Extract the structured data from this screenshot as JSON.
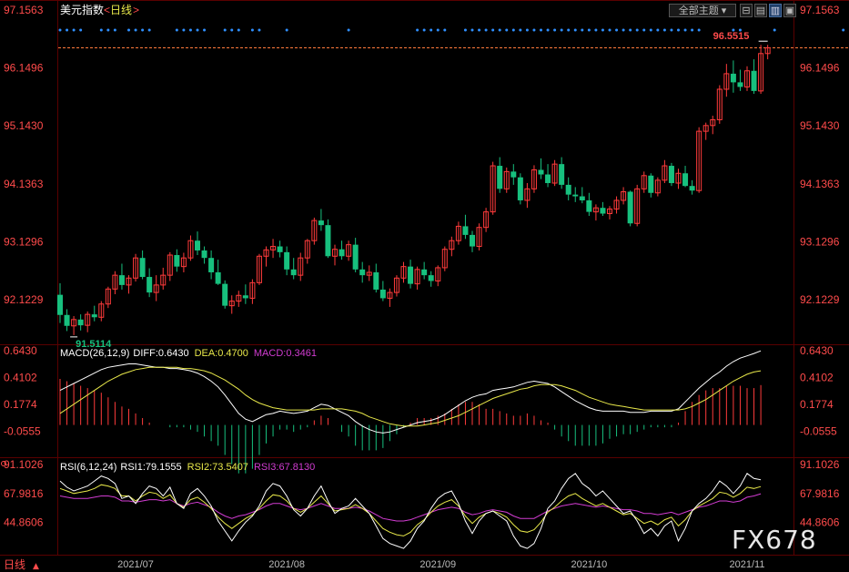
{
  "header": {
    "title": "美元指数",
    "period_open": "<",
    "period": "日线",
    "period_close": ">"
  },
  "toolbar": {
    "theme_label": "全部主题",
    "theme_arrow": "▾",
    "btn1": "⊟",
    "btn2": "▤",
    "btn3": "▥",
    "btn4": "▣"
  },
  "bottom": {
    "period_label": "日线",
    "arrow": "▲"
  },
  "watermark": "FX678",
  "colors": {
    "up": "#ff3b3b",
    "down": "#17c07e",
    "axis_text": "#ff4b4b",
    "white": "#ffffff",
    "yellow": "#e8e84a",
    "magenta": "#d23cd2",
    "dot_blue": "#2f8fff"
  },
  "chart_data": [
    {
      "type": "candlestick",
      "title": "美元指数",
      "y_ticks": [
        "97.1563",
        "96.1496",
        "95.1430",
        "94.1363",
        "93.1296",
        "92.1229"
      ],
      "ylim": [
        91.35,
        97.33
      ],
      "x_labels": [
        "2021/07",
        "2021/08",
        "2021/09",
        "2021/10",
        "2021/11"
      ],
      "label_candle": [
        11,
        33,
        55,
        77,
        100
      ],
      "max_label": "96.5515",
      "min_label": "91.5114",
      "dot_pattern": [
        1,
        1,
        1,
        1,
        0,
        0,
        1,
        1,
        1,
        0,
        1,
        1,
        1,
        1,
        0,
        0,
        0,
        1,
        1,
        1,
        1,
        1,
        0,
        0,
        1,
        1,
        1,
        0,
        1,
        1,
        0,
        0,
        0,
        1,
        0,
        0,
        0,
        0,
        0,
        0,
        0,
        0,
        1,
        0,
        0,
        0,
        0,
        0,
        0,
        0,
        0,
        0,
        1,
        1,
        1,
        1,
        1,
        0,
        0,
        1,
        1,
        1,
        1,
        1,
        1,
        1,
        1,
        1,
        1,
        1,
        1,
        1,
        1,
        1,
        1,
        1,
        1,
        1,
        1,
        1,
        1,
        1,
        1,
        1,
        1,
        1,
        1,
        1,
        1,
        1,
        1,
        1,
        1,
        1,
        0,
        0,
        0,
        0,
        1,
        1,
        0,
        0,
        0,
        0,
        1,
        0,
        0,
        0,
        0,
        0,
        0,
        0,
        0,
        0,
        1
      ],
      "ohlc": [
        [
          92.21,
          92.41,
          91.72,
          91.86
        ],
        [
          91.86,
          91.96,
          91.58,
          91.67
        ],
        [
          91.67,
          91.84,
          91.51,
          91.78
        ],
        [
          91.78,
          91.87,
          91.59,
          91.68
        ],
        [
          91.68,
          91.92,
          91.56,
          91.87
        ],
        [
          91.87,
          92.02,
          91.75,
          91.82
        ],
        [
          91.82,
          92.1,
          91.75,
          92.05
        ],
        [
          92.05,
          92.35,
          91.98,
          92.31
        ],
        [
          92.31,
          92.62,
          92.22,
          92.55
        ],
        [
          92.55,
          92.75,
          92.3,
          92.38
        ],
        [
          92.38,
          92.55,
          92.23,
          92.5
        ],
        [
          92.5,
          92.92,
          92.44,
          92.85
        ],
        [
          92.85,
          92.98,
          92.48,
          92.52
        ],
        [
          92.52,
          92.67,
          92.17,
          92.25
        ],
        [
          92.25,
          92.55,
          92.1,
          92.38
        ],
        [
          92.38,
          92.68,
          92.3,
          92.55
        ],
        [
          92.55,
          92.95,
          92.45,
          92.9
        ],
        [
          92.9,
          93.0,
          92.61,
          92.7
        ],
        [
          92.7,
          92.94,
          92.6,
          92.85
        ],
        [
          92.85,
          93.24,
          92.8,
          93.15
        ],
        [
          93.15,
          93.31,
          92.9,
          92.98
        ],
        [
          92.98,
          93.05,
          92.75,
          92.85
        ],
        [
          92.85,
          92.98,
          92.48,
          92.6
        ],
        [
          92.6,
          92.82,
          92.38,
          92.4
        ],
        [
          92.4,
          92.46,
          91.97,
          92.02
        ],
        [
          92.02,
          92.2,
          91.88,
          92.1
        ],
        [
          92.1,
          92.28,
          92.0,
          92.2
        ],
        [
          92.2,
          92.39,
          92.05,
          92.15
        ],
        [
          92.15,
          92.48,
          92.05,
          92.42
        ],
        [
          92.42,
          92.92,
          92.38,
          92.88
        ],
        [
          92.88,
          93.05,
          92.7,
          92.99
        ],
        [
          92.99,
          93.18,
          92.85,
          93.05
        ],
        [
          93.05,
          93.15,
          92.86,
          92.95
        ],
        [
          92.95,
          93.05,
          92.55,
          92.65
        ],
        [
          92.65,
          92.85,
          92.48,
          92.55
        ],
        [
          92.55,
          92.94,
          92.45,
          92.85
        ],
        [
          92.85,
          93.18,
          92.75,
          93.15
        ],
        [
          93.15,
          93.55,
          93.08,
          93.5
        ],
        [
          93.5,
          93.7,
          93.32,
          93.42
        ],
        [
          93.42,
          93.52,
          92.85,
          92.88
        ],
        [
          92.88,
          93.08,
          92.72,
          93.0
        ],
        [
          93.0,
          93.15,
          92.82,
          92.88
        ],
        [
          92.88,
          93.15,
          92.8,
          93.08
        ],
        [
          93.08,
          93.2,
          92.6,
          92.65
        ],
        [
          92.65,
          92.78,
          92.42,
          92.55
        ],
        [
          92.55,
          92.72,
          92.45,
          92.6
        ],
        [
          92.6,
          92.75,
          92.25,
          92.3
        ],
        [
          92.3,
          92.45,
          92.1,
          92.15
        ],
        [
          92.15,
          92.32,
          92.0,
          92.25
        ],
        [
          92.25,
          92.55,
          92.18,
          92.5
        ],
        [
          92.5,
          92.78,
          92.42,
          92.7
        ],
        [
          92.7,
          92.82,
          92.32,
          92.4
        ],
        [
          92.4,
          92.7,
          92.3,
          92.65
        ],
        [
          92.65,
          92.78,
          92.48,
          92.55
        ],
        [
          92.55,
          92.62,
          92.35,
          92.45
        ],
        [
          92.45,
          92.72,
          92.36,
          92.68
        ],
        [
          92.68,
          93.05,
          92.62,
          93.0
        ],
        [
          93.0,
          93.22,
          92.88,
          93.15
        ],
        [
          93.15,
          93.48,
          93.08,
          93.4
        ],
        [
          93.4,
          93.6,
          93.18,
          93.25
        ],
        [
          93.25,
          93.32,
          92.95,
          93.05
        ],
        [
          93.05,
          93.45,
          92.98,
          93.38
        ],
        [
          93.38,
          93.72,
          93.3,
          93.65
        ],
        [
          93.65,
          94.52,
          93.6,
          94.45
        ],
        [
          94.45,
          94.6,
          93.98,
          94.05
        ],
        [
          94.05,
          94.42,
          93.98,
          94.35
        ],
        [
          94.35,
          94.48,
          94.12,
          94.25
        ],
        [
          94.25,
          94.32,
          93.78,
          93.85
        ],
        [
          93.85,
          94.15,
          93.72,
          94.05
        ],
        [
          94.05,
          94.46,
          93.98,
          94.38
        ],
        [
          94.38,
          94.58,
          94.22,
          94.3
        ],
        [
          94.3,
          94.48,
          94.08,
          94.15
        ],
        [
          94.15,
          94.55,
          94.1,
          94.48
        ],
        [
          94.48,
          94.6,
          94.05,
          94.12
        ],
        [
          94.12,
          94.25,
          93.85,
          93.95
        ],
        [
          93.95,
          94.08,
          93.82,
          93.92
        ],
        [
          93.92,
          94.08,
          93.8,
          93.85
        ],
        [
          93.85,
          93.98,
          93.58,
          93.65
        ],
        [
          93.65,
          93.78,
          93.5,
          93.72
        ],
        [
          93.72,
          93.82,
          93.58,
          93.62
        ],
        [
          93.62,
          93.75,
          93.52,
          93.7
        ],
        [
          93.7,
          93.92,
          93.62,
          93.85
        ],
        [
          93.85,
          94.08,
          93.78,
          94.0
        ],
        [
          94.0,
          94.02,
          93.4,
          93.45
        ],
        [
          93.45,
          94.12,
          93.4,
          94.05
        ],
        [
          94.05,
          94.35,
          93.98,
          94.28
        ],
        [
          94.28,
          94.32,
          93.9,
          93.98
        ],
        [
          93.98,
          94.25,
          93.92,
          94.2
        ],
        [
          94.2,
          94.55,
          94.15,
          94.45
        ],
        [
          94.45,
          94.5,
          94.1,
          94.15
        ],
        [
          94.15,
          94.4,
          94.05,
          94.32
        ],
        [
          94.32,
          94.45,
          94.08,
          94.1
        ],
        [
          94.1,
          94.2,
          93.95,
          94.02
        ],
        [
          94.02,
          95.12,
          93.98,
          95.05
        ],
        [
          95.05,
          95.2,
          94.9,
          95.15
        ],
        [
          95.15,
          95.32,
          95.0,
          95.25
        ],
        [
          95.25,
          95.85,
          95.18,
          95.78
        ],
        [
          95.78,
          96.22,
          95.65,
          96.05
        ],
        [
          96.05,
          96.28,
          95.72,
          95.9
        ],
        [
          95.9,
          96.12,
          95.75,
          95.82
        ],
        [
          95.82,
          96.18,
          95.75,
          96.1
        ],
        [
          96.1,
          96.3,
          95.7,
          95.75
        ],
        [
          95.75,
          96.55,
          95.7,
          96.4
        ],
        [
          96.4,
          96.5515,
          96.3,
          96.5
        ]
      ]
    },
    {
      "type": "macd",
      "title": "MACD(26,12,9)",
      "diff_label": "DIFF:0.6430",
      "dea_label": "DEA:0.4700",
      "macd_label": "MACD:0.3461",
      "y_ticks": [
        "0.6430",
        "0.4102",
        "0.1774",
        "-0.0555"
      ],
      "ylim": [
        -0.28,
        0.7
      ],
      "diff": [
        0.3,
        0.33,
        0.36,
        0.39,
        0.42,
        0.45,
        0.48,
        0.5,
        0.51,
        0.52,
        0.53,
        0.53,
        0.52,
        0.51,
        0.5,
        0.5,
        0.49,
        0.49,
        0.48,
        0.47,
        0.45,
        0.42,
        0.38,
        0.33,
        0.26,
        0.18,
        0.1,
        0.05,
        0.03,
        0.06,
        0.09,
        0.1,
        0.12,
        0.11,
        0.1,
        0.11,
        0.12,
        0.15,
        0.18,
        0.17,
        0.14,
        0.11,
        0.08,
        0.03,
        -0.01,
        -0.04,
        -0.06,
        -0.07,
        -0.06,
        -0.04,
        -0.02,
        0.0,
        0.02,
        0.03,
        0.04,
        0.06,
        0.09,
        0.13,
        0.17,
        0.21,
        0.24,
        0.26,
        0.27,
        0.3,
        0.31,
        0.32,
        0.33,
        0.35,
        0.37,
        0.38,
        0.37,
        0.36,
        0.33,
        0.29,
        0.25,
        0.21,
        0.18,
        0.15,
        0.13,
        0.12,
        0.12,
        0.12,
        0.12,
        0.11,
        0.11,
        0.11,
        0.12,
        0.12,
        0.12,
        0.12,
        0.14,
        0.2,
        0.26,
        0.32,
        0.37,
        0.42,
        0.46,
        0.51,
        0.55,
        0.58,
        0.6,
        0.62,
        0.643
      ],
      "dea": [
        0.1,
        0.14,
        0.18,
        0.22,
        0.26,
        0.3,
        0.34,
        0.38,
        0.41,
        0.44,
        0.46,
        0.48,
        0.49,
        0.5,
        0.5,
        0.5,
        0.5,
        0.5,
        0.49,
        0.49,
        0.48,
        0.47,
        0.45,
        0.42,
        0.39,
        0.35,
        0.31,
        0.26,
        0.22,
        0.19,
        0.17,
        0.15,
        0.14,
        0.13,
        0.13,
        0.13,
        0.13,
        0.13,
        0.14,
        0.14,
        0.14,
        0.14,
        0.13,
        0.12,
        0.1,
        0.07,
        0.05,
        0.03,
        0.01,
        0.0,
        -0.01,
        -0.01,
        -0.01,
        0.0,
        0.01,
        0.02,
        0.04,
        0.06,
        0.08,
        0.11,
        0.14,
        0.17,
        0.2,
        0.23,
        0.25,
        0.27,
        0.29,
        0.31,
        0.32,
        0.34,
        0.35,
        0.35,
        0.35,
        0.34,
        0.32,
        0.3,
        0.27,
        0.24,
        0.22,
        0.2,
        0.18,
        0.17,
        0.16,
        0.15,
        0.14,
        0.13,
        0.13,
        0.13,
        0.13,
        0.13,
        0.13,
        0.14,
        0.16,
        0.19,
        0.22,
        0.26,
        0.3,
        0.34,
        0.38,
        0.41,
        0.44,
        0.46,
        0.47
      ]
    },
    {
      "type": "rsi",
      "title": "RSI(6,12,24)",
      "rsi1_label": "RSI1:79.1555",
      "rsi2_label": "RSI2:73.5407",
      "rsi3_label": "RSI3:67.8130",
      "y_ticks": [
        "91.1026",
        "67.9816",
        "44.8606"
      ],
      "ylim": [
        19,
        97
      ],
      "rsi1": [
        78,
        73,
        70,
        72,
        74,
        78,
        82,
        80,
        76,
        64,
        66,
        60,
        68,
        74,
        72,
        66,
        73,
        60,
        56,
        68,
        72,
        66,
        58,
        46,
        38,
        30,
        38,
        45,
        50,
        58,
        70,
        76,
        74,
        66,
        55,
        50,
        56,
        66,
        74,
        62,
        52,
        56,
        58,
        64,
        58,
        52,
        42,
        32,
        28,
        26,
        24,
        30,
        40,
        46,
        56,
        64,
        68,
        70,
        60,
        46,
        36,
        46,
        52,
        54,
        50,
        46,
        34,
        26,
        24,
        28,
        40,
        56,
        62,
        72,
        80,
        84,
        76,
        72,
        66,
        70,
        64,
        58,
        52,
        54,
        46,
        36,
        40,
        34,
        42,
        46,
        30,
        40,
        54,
        60,
        64,
        70,
        78,
        74,
        68,
        74,
        84,
        80,
        79
      ],
      "rsi2": [
        72,
        70,
        68,
        69,
        70,
        72,
        75,
        74,
        72,
        66,
        66,
        62,
        66,
        69,
        68,
        64,
        67,
        60,
        57,
        63,
        65,
        61,
        56,
        49,
        44,
        40,
        44,
        48,
        51,
        56,
        62,
        67,
        66,
        62,
        56,
        53,
        56,
        61,
        66,
        60,
        54,
        55,
        56,
        59,
        56,
        52,
        46,
        40,
        37,
        35,
        34,
        37,
        43,
        47,
        53,
        58,
        61,
        63,
        58,
        50,
        44,
        49,
        52,
        54,
        52,
        49,
        43,
        38,
        37,
        39,
        45,
        53,
        57,
        62,
        66,
        68,
        64,
        61,
        58,
        60,
        57,
        54,
        51,
        52,
        48,
        44,
        46,
        43,
        47,
        49,
        42,
        47,
        54,
        58,
        61,
        64,
        69,
        68,
        65,
        68,
        73,
        72,
        73.5
      ],
      "rsi3": [
        66,
        65,
        64,
        64,
        64,
        65,
        66,
        66,
        65,
        62,
        62,
        61,
        62,
        63,
        63,
        62,
        63,
        60,
        58,
        60,
        61,
        59,
        57,
        53,
        50,
        48,
        50,
        51,
        53,
        55,
        58,
        60,
        60,
        58,
        56,
        55,
        56,
        58,
        60,
        58,
        56,
        56,
        56,
        57,
        56,
        54,
        51,
        48,
        47,
        46,
        46,
        47,
        49,
        51,
        53,
        55,
        56,
        57,
        56,
        53,
        51,
        52,
        54,
        55,
        54,
        53,
        50,
        48,
        48,
        48,
        51,
        54,
        56,
        58,
        59,
        60,
        59,
        58,
        57,
        58,
        57,
        56,
        55,
        55,
        54,
        52,
        52,
        51,
        52,
        53,
        51,
        53,
        55,
        57,
        58,
        60,
        62,
        62,
        61,
        62,
        65,
        66,
        67.8
      ]
    }
  ]
}
